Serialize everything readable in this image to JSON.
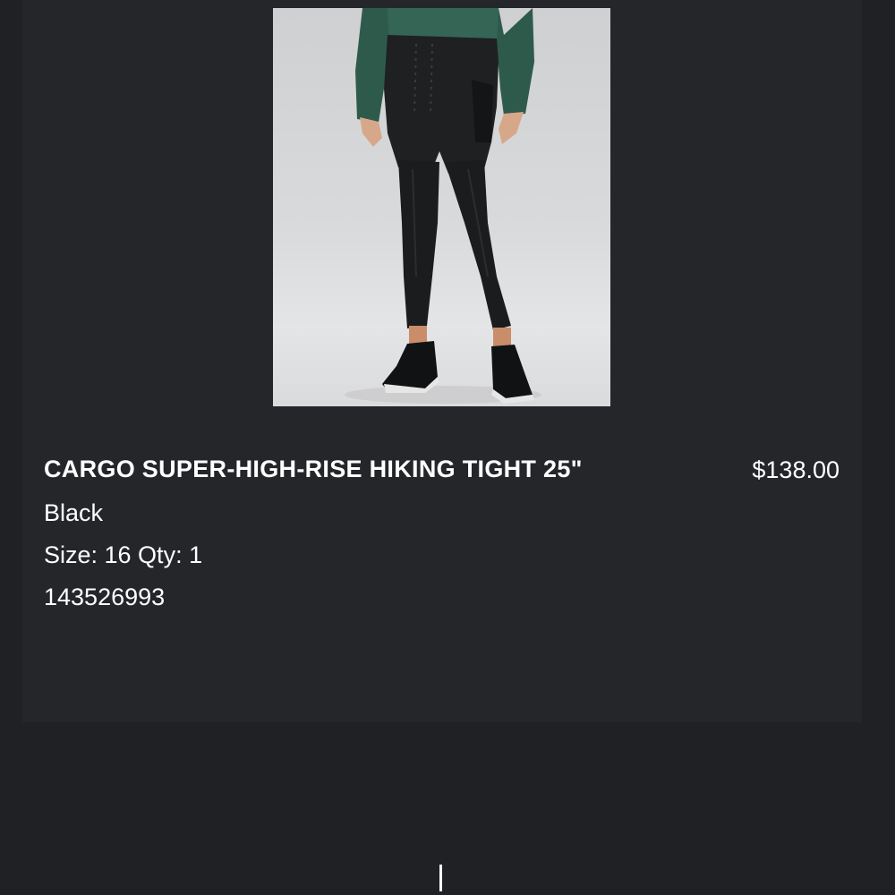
{
  "item": {
    "image_icon": "product-photo-leggings",
    "title": "CARGO SUPER-HIGH-RISE HIKING TIGHT 25\"",
    "color": "Black",
    "size_qty": "Size: 16 Qty: 1",
    "item_number": "143526993",
    "price": "$138.00"
  },
  "colors": {
    "page_background": "#202124",
    "card_background": "#25262a",
    "text": "#ffffff"
  }
}
